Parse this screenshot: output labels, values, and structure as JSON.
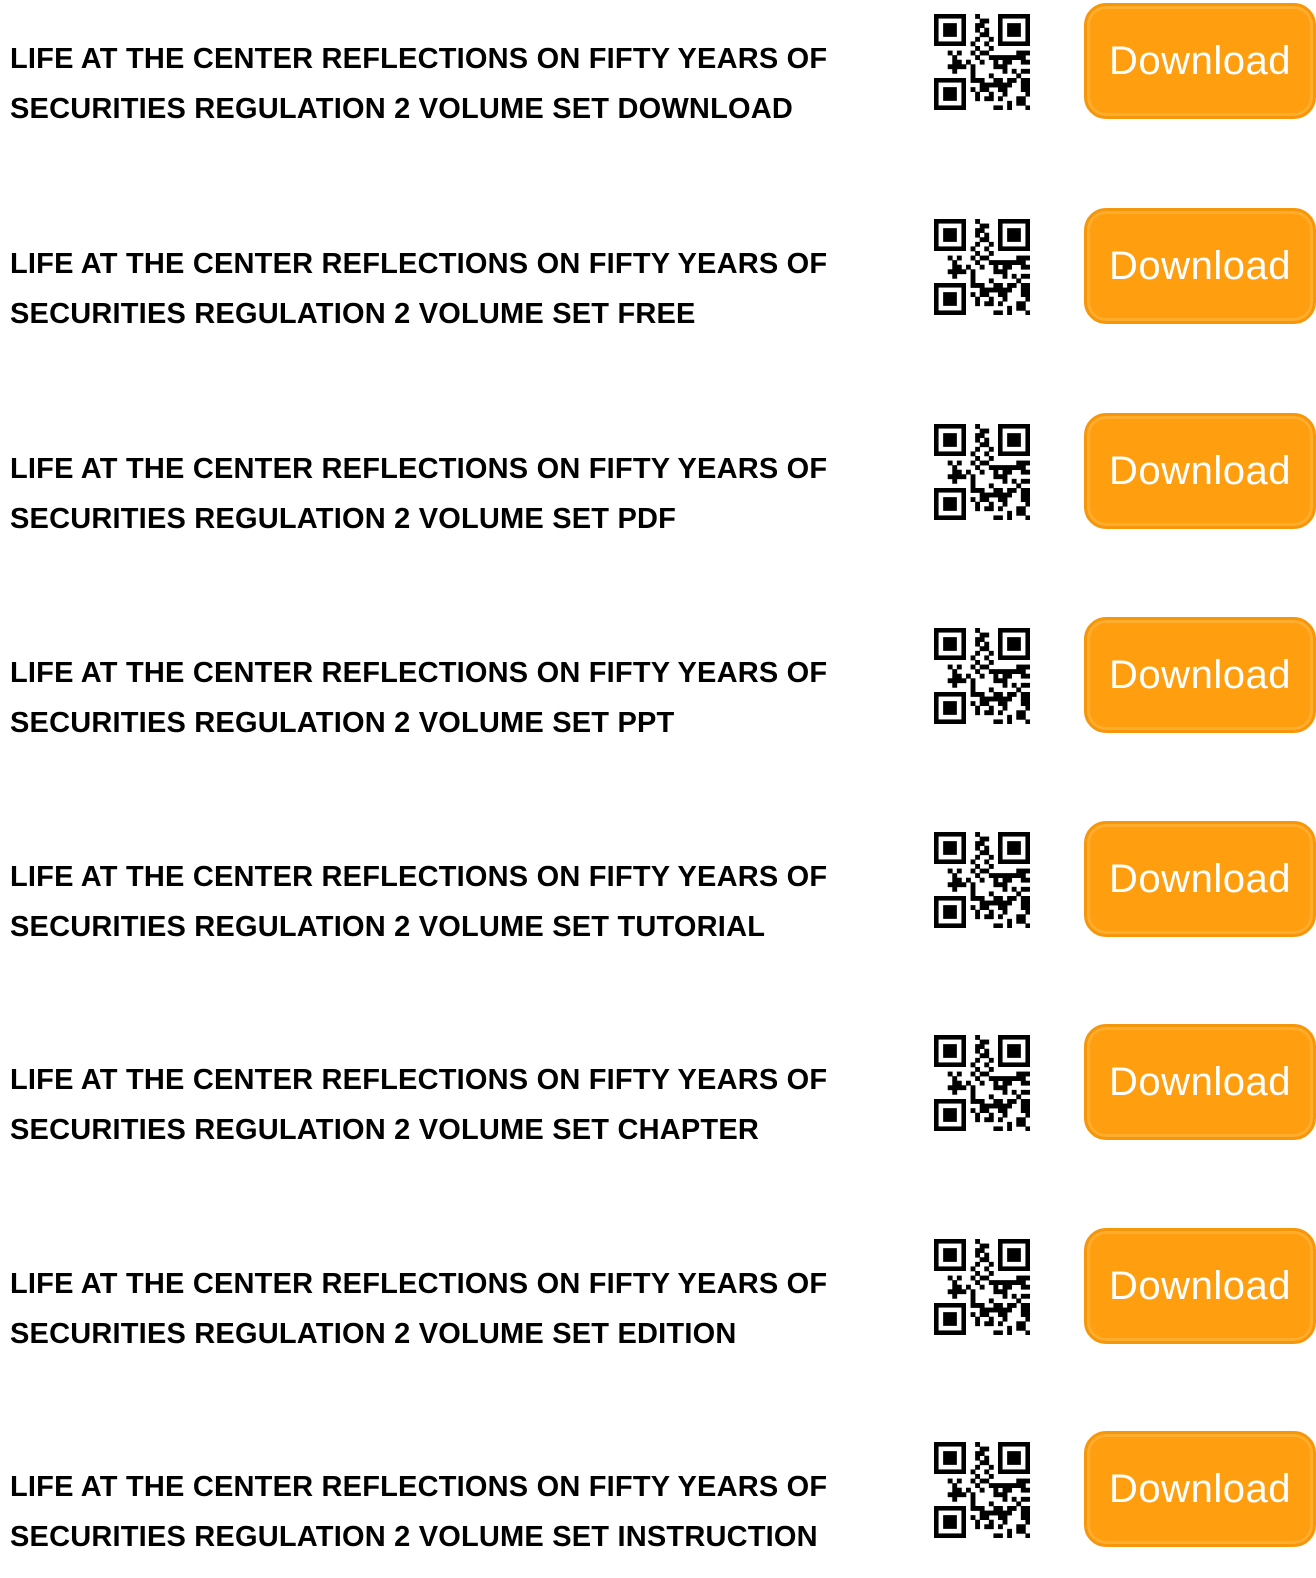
{
  "colors": {
    "button_fill": "#ff9e0f",
    "button_text": "#ffffff",
    "title_text": "#000000",
    "qr": "#000000"
  },
  "items": [
    {
      "title": "LIFE AT THE CENTER REFLECTIONS ON FIFTY YEARS OF SECURITIES REGULATION 2 VOLUME SET DOWNLOAD",
      "qr_icon": "qr-code-icon",
      "button_label": "Download"
    },
    {
      "title": "LIFE AT THE CENTER REFLECTIONS ON FIFTY YEARS OF SECURITIES REGULATION 2 VOLUME SET FREE",
      "qr_icon": "qr-code-icon",
      "button_label": "Download"
    },
    {
      "title": "LIFE AT THE CENTER REFLECTIONS ON FIFTY YEARS OF SECURITIES REGULATION 2 VOLUME SET PDF",
      "qr_icon": "qr-code-icon",
      "button_label": "Download"
    },
    {
      "title": "LIFE AT THE CENTER REFLECTIONS ON FIFTY YEARS OF SECURITIES REGULATION 2 VOLUME SET PPT",
      "qr_icon": "qr-code-icon",
      "button_label": "Download"
    },
    {
      "title": "LIFE AT THE CENTER REFLECTIONS ON FIFTY YEARS OF SECURITIES REGULATION 2 VOLUME SET TUTORIAL",
      "qr_icon": "qr-code-icon",
      "button_label": "Download"
    },
    {
      "title": "LIFE AT THE CENTER REFLECTIONS ON FIFTY YEARS OF SECURITIES REGULATION 2 VOLUME SET CHAPTER",
      "qr_icon": "qr-code-icon",
      "button_label": "Download"
    },
    {
      "title": "LIFE AT THE CENTER REFLECTIONS ON FIFTY YEARS OF SECURITIES REGULATION 2 VOLUME SET EDITION",
      "qr_icon": "qr-code-icon",
      "button_label": "Download"
    },
    {
      "title": "LIFE AT THE CENTER REFLECTIONS ON FIFTY YEARS OF SECURITIES REGULATION 2 VOLUME SET INSTRUCTION",
      "qr_icon": "qr-code-icon",
      "button_label": "Download"
    }
  ]
}
